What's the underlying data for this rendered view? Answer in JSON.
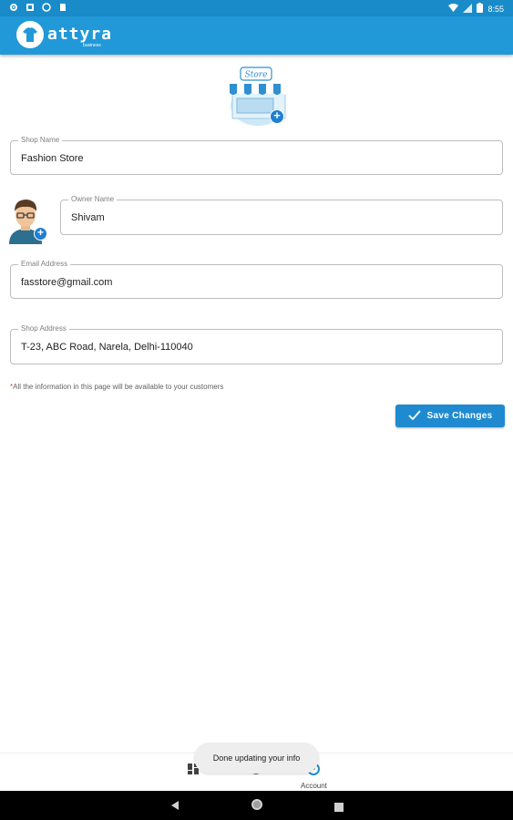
{
  "status_bar": {
    "time": "8:55"
  },
  "app_bar": {
    "logo_text": "attyra",
    "logo_subtext": "business"
  },
  "store_illustration": {
    "sign_text": "Store"
  },
  "form": {
    "shop_name": {
      "label": "Shop Name",
      "value": "Fashion Store"
    },
    "owner_name": {
      "label": "Owner Name",
      "value": "Shivam"
    },
    "email": {
      "label": "Email Address",
      "value": "fasstore@gmail.com"
    },
    "shop_address": {
      "label": "Shop Address",
      "value": "T-23, ABC Road, Narela, Delhi-110040"
    }
  },
  "note": {
    "asterisk": "*",
    "text": "All the information in this page will be available to your customers"
  },
  "save_button": {
    "label": "Save Changes"
  },
  "bottom_nav": {
    "account_label": "Account"
  },
  "toast": {
    "text": "Done updating your info"
  },
  "colors": {
    "primary": "#2199d8",
    "status_bar": "#1a8bc9",
    "button": "#1f8ad0",
    "required": "#e53935"
  }
}
